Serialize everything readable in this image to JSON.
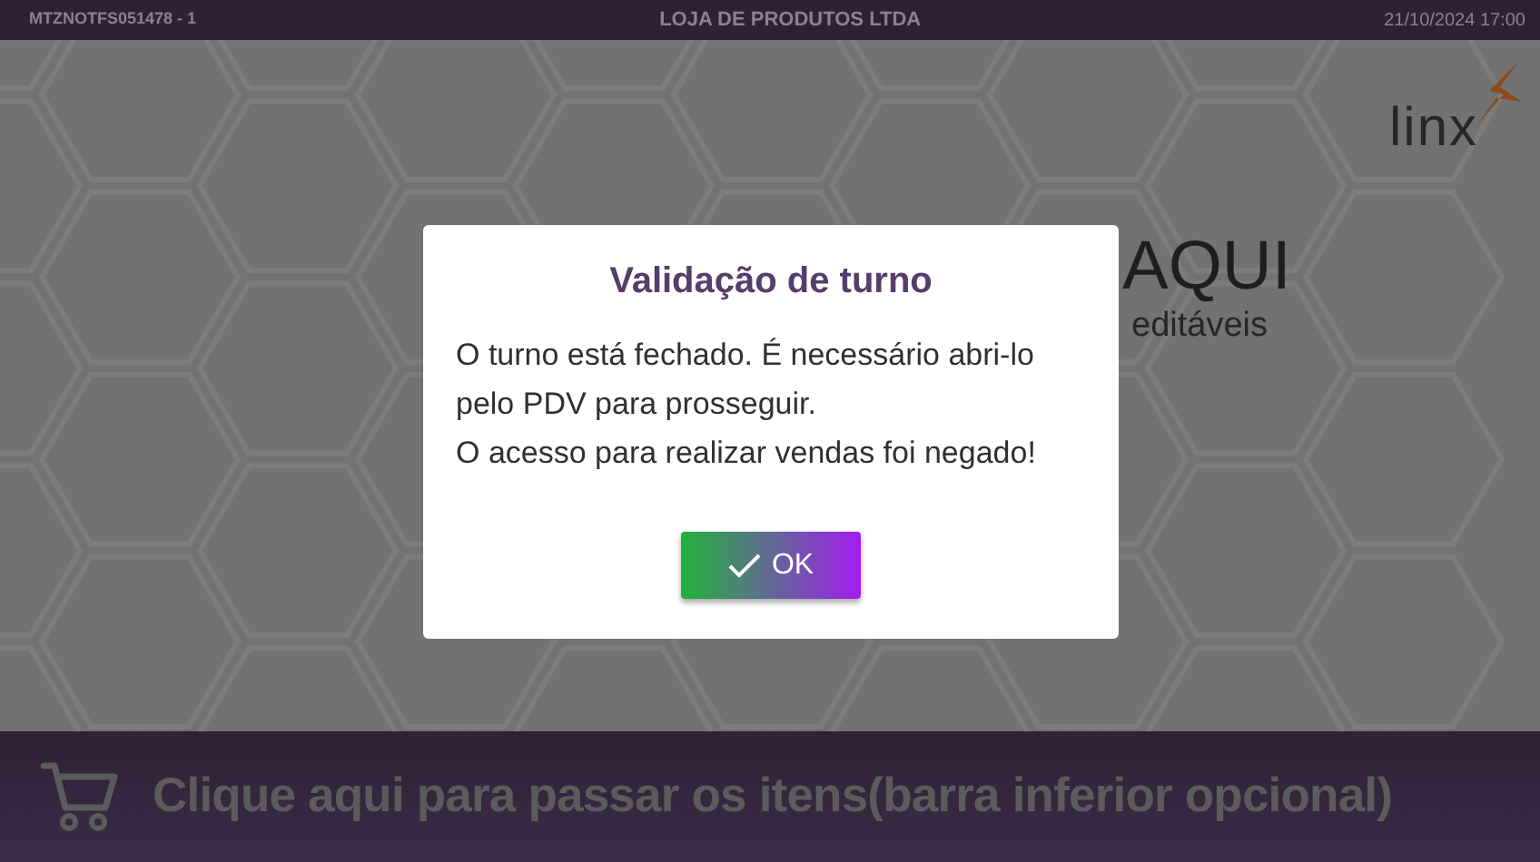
{
  "top_bar": {
    "terminal": "MTZNOTFS051478 - 1",
    "store": "LOJA DE PRODUTOS LTDA",
    "datetime": "21/10/2024 17:00"
  },
  "background": {
    "logo": "linx",
    "headline": "AQUI",
    "subtitle": "editáveis"
  },
  "dialog": {
    "title": "Validação de turno",
    "paragraphs": [
      "O turno está fechado. É necessário abri-lo pelo PDV para prosseguir.",
      "O acesso para realizar vendas foi negado!"
    ],
    "button": "OK"
  },
  "bottom_bar": {
    "label": "Clique aqui para passar os itens(barra inferior opcional)"
  }
}
